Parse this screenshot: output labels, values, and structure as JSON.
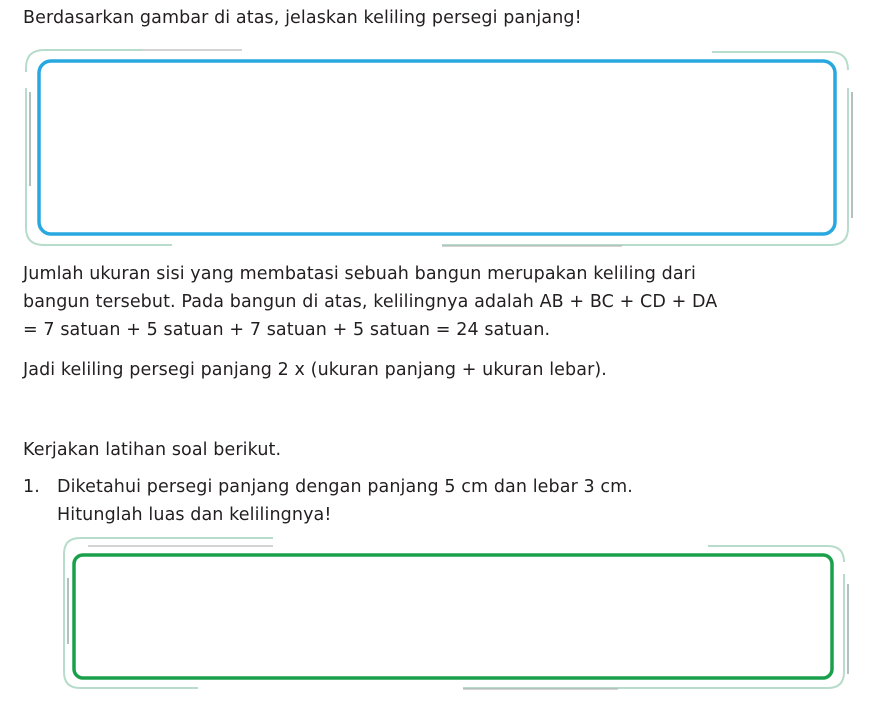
{
  "question_prompt": "Berdasarkan gambar di atas, jelaskan keliling persegi panjang!",
  "explanation": {
    "line1": "Jumlah ukuran sisi yang membatasi sebuah bangun merupakan keliling dari",
    "line2": "bangun tersebut. Pada bangun di atas, kelilingnya adalah AB + BC + CD + DA",
    "line3": "= 7 satuan + 5 satuan + 7 satuan + 5 satuan = 24 satuan.",
    "line4": "Jadi keliling persegi panjang 2 x (ukuran panjang + ukuran lebar)."
  },
  "exercise": {
    "instruction": "Kerjakan latihan soal berikut.",
    "item_number": "1.",
    "item_line1": "Diketahui persegi panjang dengan panjang 5 cm dan lebar 3 cm.",
    "item_line2": "Hitunglah luas dan kelilingnya!"
  },
  "colors": {
    "text": "#231f20",
    "frame_blue": "#29a8e0",
    "frame_green": "#1aa04b",
    "frame_outline": "#b8dccb"
  }
}
